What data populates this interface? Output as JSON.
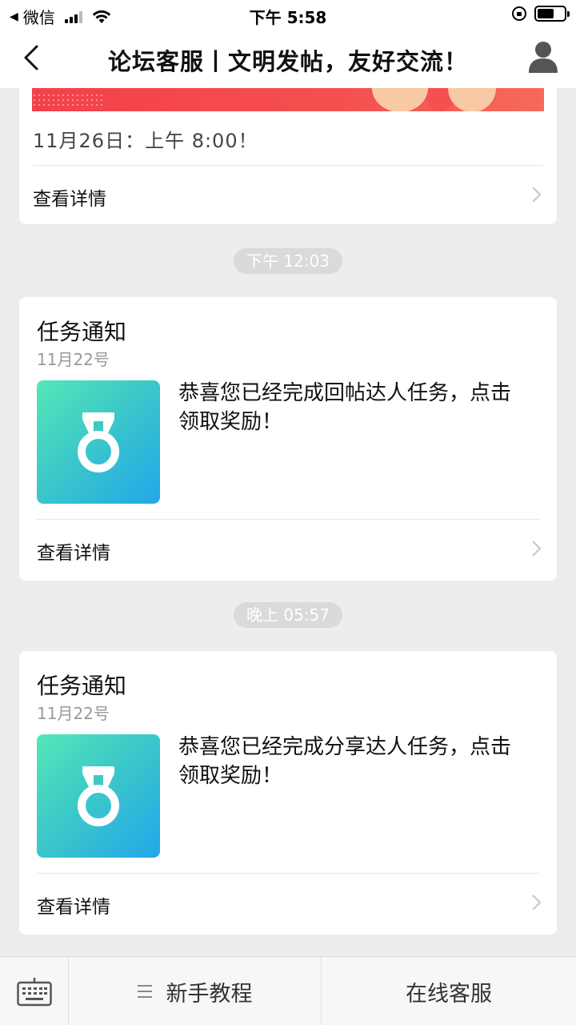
{
  "status_bar": {
    "back_app": "微信",
    "time": "下午 5:58"
  },
  "nav": {
    "title": "论坛客服丨文明发帖，友好交流！"
  },
  "top_card": {
    "date_text": "11月26日：上午 8:00！",
    "detail_label": "查看详情"
  },
  "messages": [
    {
      "timestamp": "下午 12:03",
      "title": "任务通知",
      "date": "11月22号",
      "icon": "medal-icon",
      "text": "恭喜您已经完成回帖达人任务，点击领取奖励！",
      "detail_label": "查看详情"
    },
    {
      "timestamp": "晚上 05:57",
      "title": "任务通知",
      "date": "11月22号",
      "icon": "medal-icon",
      "text": "恭喜您已经完成分享达人任务，点击领取奖励！",
      "detail_label": "查看详情"
    }
  ],
  "bottom_bar": {
    "menu_1": "新手教程",
    "menu_2": "在线客服"
  },
  "colors": {
    "accent_gradient_start": "#55e6b8",
    "accent_gradient_end": "#23a6ea",
    "banner_red": "#f3404a"
  }
}
